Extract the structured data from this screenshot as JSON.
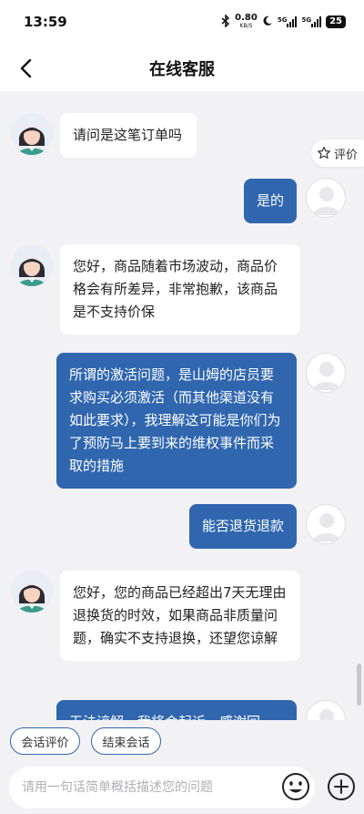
{
  "status_bar": {
    "time": "13:59",
    "net_speed": "0.80",
    "net_unit": "KB/S",
    "network_1": "5G",
    "network_2": "5G",
    "battery": "25"
  },
  "header": {
    "title": "在线客服"
  },
  "rate_button": {
    "label": "评价"
  },
  "messages": [
    {
      "sender": "agent",
      "text": "请问是这笔订单吗"
    },
    {
      "sender": "user",
      "text": "是的"
    },
    {
      "sender": "agent",
      "text": "您好，商品随着市场波动，商品价格会有所差异，非常抱歉，该商品是不支持价保"
    },
    {
      "sender": "user",
      "text": "所谓的激活问题，是山姆的店员要求购买必须激活（而其他渠道没有如此要求），我理解这可能是你们为了预防马上要到来的维权事件而采取的措施"
    },
    {
      "sender": "user",
      "text": "能否退货退款"
    },
    {
      "sender": "agent",
      "text": "您好，您的商品已经超出7天无理由退换货的时效，如果商品非质量问题，确实不支持退换，还望您谅解"
    },
    {
      "sender": "user",
      "text": "无法谅解，我将会起诉，感谢回"
    }
  ],
  "quick_actions": {
    "rate_session": "会话评价",
    "end_session": "结束会话"
  },
  "input": {
    "placeholder": "请用一句话简单概括描述您的问题"
  },
  "colors": {
    "accent": "#2f66ae",
    "background": "#f2f2f4"
  }
}
